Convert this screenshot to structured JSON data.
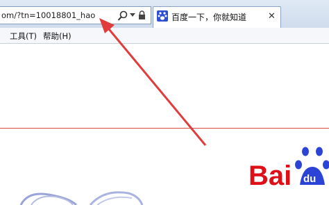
{
  "address_bar": {
    "url": "om/?tn=10018801_hao"
  },
  "tab": {
    "title": "百度一下，你就知道",
    "close": "✕"
  },
  "menu": [
    {
      "label": "工具(T)"
    },
    {
      "label": "帮助(H)"
    }
  ],
  "logo": {
    "text_left": "Bai",
    "text_right": "du"
  },
  "colors": {
    "annotation_red": "#e03c3c",
    "baidu_red": "#de0f17",
    "baidu_blue": "#2b44d6"
  }
}
